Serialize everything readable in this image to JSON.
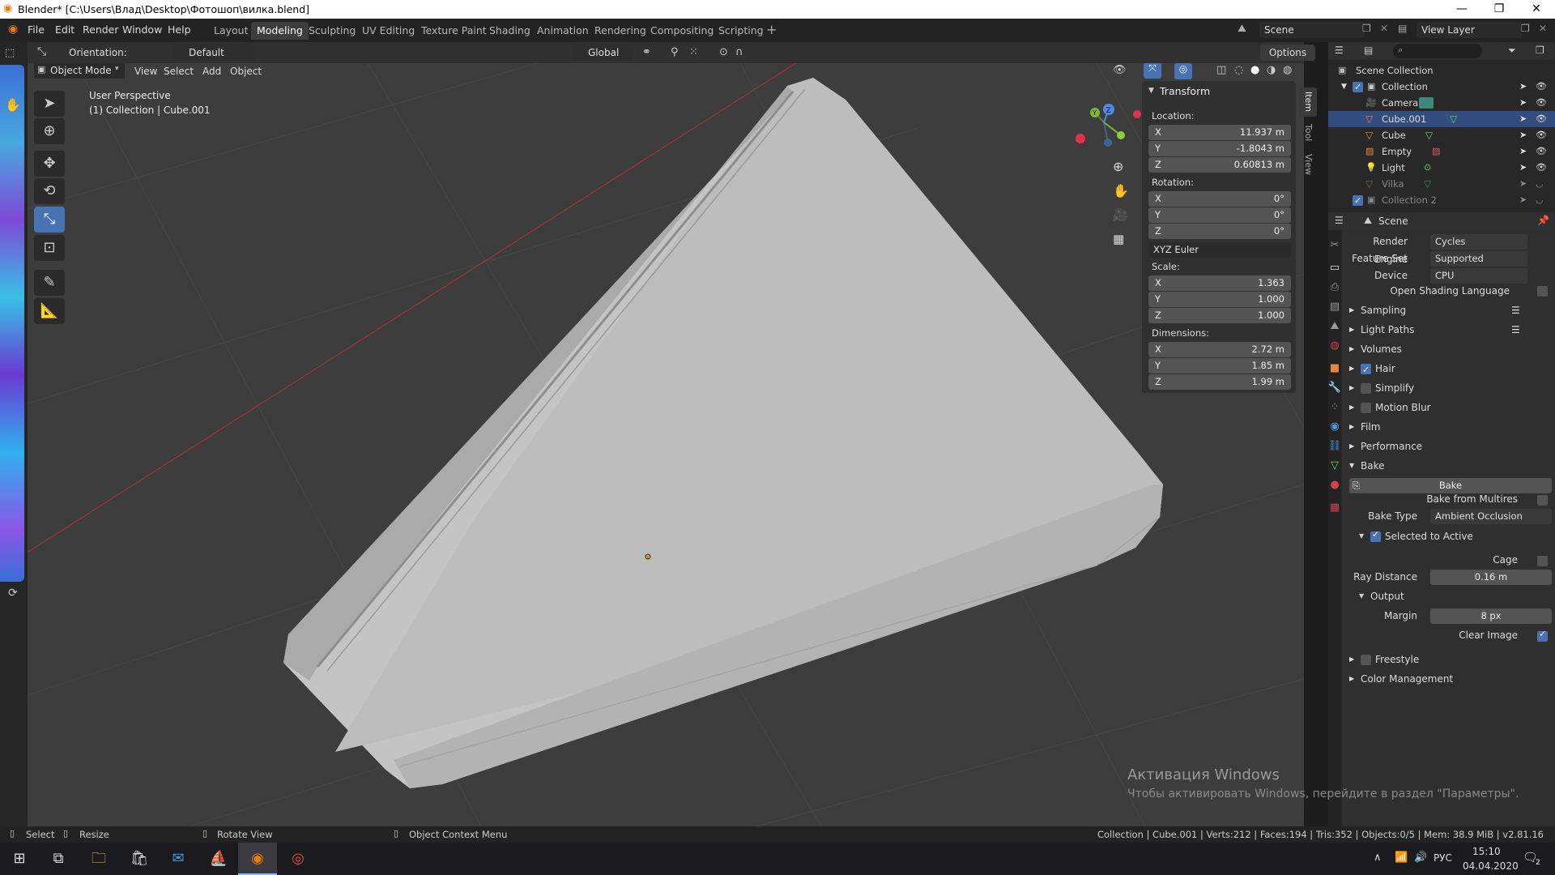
{
  "title": "Blender* [C:\\Users\\Влад\\Desktop\\Фотошоп\\вилка.blend]",
  "menu": [
    "File",
    "Edit",
    "Render",
    "Window",
    "Help"
  ],
  "workspaces": [
    "Layout",
    "Modeling",
    "Sculpting",
    "UV Editing",
    "Texture Paint",
    "Shading",
    "Animation",
    "Rendering",
    "Compositing",
    "Scripting"
  ],
  "active_workspace": "Modeling",
  "scene": "Scene",
  "view_layer": "View Layer",
  "header": {
    "orientation_label": "Orientation:",
    "orientation": "Default",
    "transform": "Global",
    "options": "Options"
  },
  "viewport_header": {
    "mode": "Object Mode",
    "items": [
      "View",
      "Select",
      "Add",
      "Object"
    ]
  },
  "overlay": {
    "perspective": "User Perspective",
    "collection": "(1) Collection | Cube.001"
  },
  "npanel": {
    "title": "Transform",
    "location_label": "Location:",
    "location": [
      {
        "ax": "X",
        "v": "11.937 m"
      },
      {
        "ax": "Y",
        "v": "-1.8043 m"
      },
      {
        "ax": "Z",
        "v": "0.60813 m"
      }
    ],
    "rotation_label": "Rotation:",
    "rotation": [
      {
        "ax": "X",
        "v": "0°"
      },
      {
        "ax": "Y",
        "v": "0°"
      },
      {
        "ax": "Z",
        "v": "0°"
      }
    ],
    "rotation_mode": "XYZ Euler",
    "scale_label": "Scale:",
    "scale": [
      {
        "ax": "X",
        "v": "1.363"
      },
      {
        "ax": "Y",
        "v": "1.000"
      },
      {
        "ax": "Z",
        "v": "1.000"
      }
    ],
    "dimensions_label": "Dimensions:",
    "dimensions": [
      {
        "ax": "X",
        "v": "2.72 m"
      },
      {
        "ax": "Y",
        "v": "1.85 m"
      },
      {
        "ax": "Z",
        "v": "1.99 m"
      }
    ],
    "tabs": [
      "Item",
      "Tool",
      "View"
    ]
  },
  "outliner": {
    "root": "Scene Collection",
    "items": [
      {
        "label": "Collection",
        "color": "#dcdcdc"
      },
      {
        "label": "Camera",
        "color": "#dcdcdc"
      },
      {
        "label": "Cube.001",
        "color": "#dcdcdc"
      },
      {
        "label": "Cube",
        "color": "#dcdcdc"
      },
      {
        "label": "Empty",
        "color": "#dcdcdc"
      },
      {
        "label": "Light",
        "color": "#dcdcdc"
      },
      {
        "label": "Vilka",
        "color": "#8a8a8a"
      },
      {
        "label": "Collection 2",
        "color": "#8a8a8a"
      }
    ]
  },
  "properties": {
    "context": "Scene",
    "render_engine_label": "Render Engine",
    "render_engine": "Cycles",
    "feature_set_label": "Feature Set",
    "feature_set": "Supported",
    "device_label": "Device",
    "device": "CPU",
    "osl_label": "Open Shading Language",
    "panels": [
      "Sampling",
      "Light Paths",
      "Volumes",
      "Hair",
      "Simplify",
      "Motion Blur",
      "Film",
      "Performance",
      "Bake"
    ],
    "bake_button": "Bake",
    "bake_from_multires": "Bake from Multires",
    "bake_type_label": "Bake Type",
    "bake_type": "Ambient Occlusion",
    "selected_to_active": "Selected to Active",
    "cage": "Cage",
    "ray_distance_label": "Ray Distance",
    "ray_distance": "0.16 m",
    "output": "Output",
    "margin_label": "Margin",
    "margin": "8 px",
    "clear_image": "Clear Image",
    "freestyle": "Freestyle",
    "color_management": "Color Management"
  },
  "status": {
    "select": "Select",
    "resize": "Resize",
    "rotate": "Rotate View",
    "context": "Object Context Menu",
    "stats": "Collection | Cube.001 | Verts:212 | Faces:194 | Tris:352 | Objects:0/5 | Mem: 38.9 MiB | v2.81.16"
  },
  "watermark": {
    "line1": "Активация Windows",
    "line2": "Чтобы активировать Windows, перейдите в раздел \"Параметры\"."
  },
  "taskbar": {
    "lang": "РУС",
    "time": "15:10",
    "date": "04.04.2020",
    "notif": "2"
  },
  "colors": {
    "accent": "#4772b3",
    "viewport": "#3d3d3d",
    "mesh": "#bfbfbf"
  }
}
